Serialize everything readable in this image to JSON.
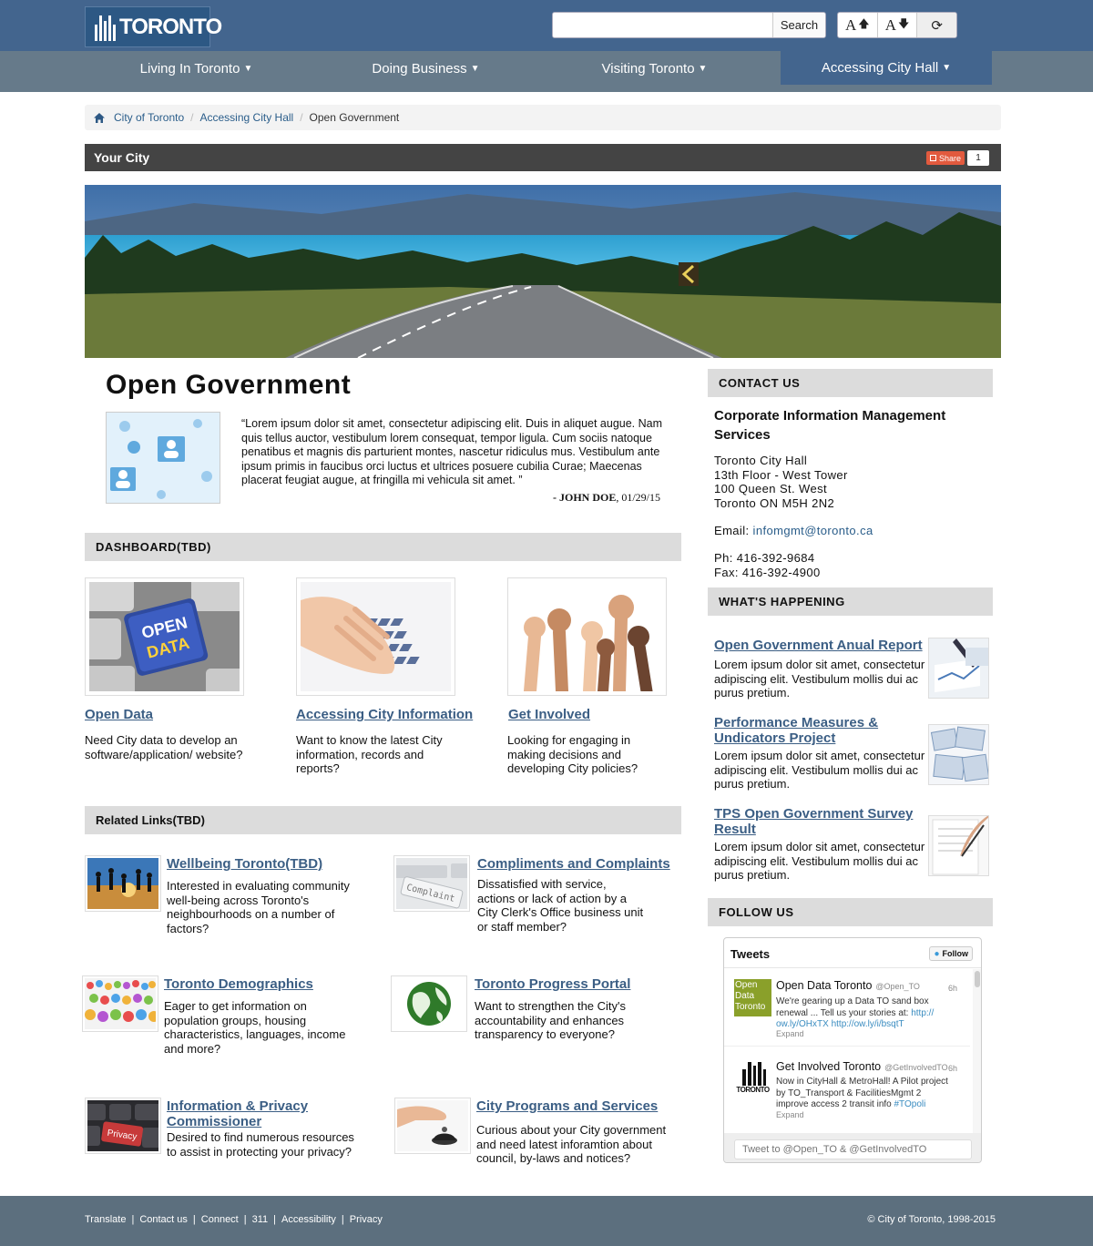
{
  "header": {
    "logo_text": "TORONTO",
    "search_placeholder": "",
    "search_button": "Search",
    "text_increase": "A",
    "text_decrease": "A",
    "up_arrow": "🡅",
    "down_arrow": "🡇",
    "refresh_glyph": "⟳"
  },
  "nav": [
    {
      "label": "Living In Toronto"
    },
    {
      "label": "Doing Business"
    },
    {
      "label": "Visiting Toronto"
    },
    {
      "label": "Accessing City Hall"
    }
  ],
  "breadcrumb": [
    "City of Toronto",
    "Accessing City Hall",
    "Open Government"
  ],
  "section_title": "Your City",
  "share": {
    "label": "Share",
    "count": "1"
  },
  "page_title": "Open Government",
  "quote": {
    "text": "“Lorem ipsum dolor sit amet, consectetur adipiscing elit. Duis in aliquet augue. Nam quis tellus auctor, vestibulum lorem consequat, tempor ligula. Cum sociis natoque penatibus et magnis dis parturient montes, nascetur ridiculus mus. Vestibulum ante ipsum primis in faucibus orci luctus et ultrices posuere cubilia Curae; Maecenas placerat feugiat augue, at fringilla mi vehicula sit amet. ”",
    "author": "- JOHN DOE",
    "date": ", 01/29/15"
  },
  "dashboard": {
    "heading": "DASHBOARD(TBD)",
    "open_data_overlay": [
      "OPEN",
      "DATA"
    ],
    "cards": [
      {
        "title": "Open Data",
        "desc": "Need City data to develop an software/application/ website?"
      },
      {
        "title": "Accessing City Information",
        "desc": "Want to know the latest City information, records and reports?"
      },
      {
        "title": "Get Involved",
        "desc": "Looking for engaging in making decisions and developing City policies?"
      }
    ]
  },
  "related": {
    "heading": "Related Links(TBD)",
    "complaint_overlay": "Complaint",
    "privacy_overlay": "Privacy",
    "items": [
      {
        "title": "Wellbeing Toronto(TBD)",
        "desc": "Interested in evaluating community well-being across Toronto's neighbourhoods on a number of factors?"
      },
      {
        "title": "Compliments and Complaints",
        "desc": "Dissatisfied with service, actions or lack of action by a City Clerk's Office business unit or staff member?"
      },
      {
        "title": "Toronto Demographics",
        "desc": "Eager to get information on population groups, housing characteristics, languages, income and more?"
      },
      {
        "title": "Toronto Progress Portal",
        "desc": "Want to strengthen the City's accountability and enhances transparency to everyone?"
      },
      {
        "title": "Information & Privacy Commissioner",
        "desc": "Desired to find numerous resources to assist in protecting your privacy?"
      },
      {
        "title": "City Programs and Services",
        "desc": "Curious about your City government and need latest inforamtion about council, by-laws and notices?"
      }
    ]
  },
  "contact": {
    "heading": "CONTACT US",
    "name": "Corporate Information Management Services",
    "address": [
      "Toronto City Hall",
      "13th Floor - West Tower",
      "100 Queen St. West",
      "Toronto ON M5H 2N2"
    ],
    "email_label": "Email: ",
    "email": "infomgmt@toronto.ca",
    "phone": "Ph: 416-392-9684",
    "fax": "Fax: 416-392-4900"
  },
  "whats_happening": {
    "heading": "WHAT'S HAPPENING",
    "items": [
      {
        "title": "Open Government Anual Report",
        "desc": "Lorem ipsum dolor sit amet, consectetur adipiscing elit. Vestibulum mollis dui ac purus pretium."
      },
      {
        "title": "Performance Measures & Undicators Project",
        "desc": "Lorem ipsum dolor sit amet, consectetur adipiscing elit. Vestibulum mollis dui ac purus pretium."
      },
      {
        "title": "TPS Open Government Survey Result",
        "desc": "Lorem ipsum dolor sit amet, consectetur adipiscing elit. Vestibulum mollis dui ac purus pretium."
      }
    ]
  },
  "follow": {
    "heading": "FOLLOW US",
    "tweets_title": "Tweets",
    "follow_button": "Follow",
    "tweets": [
      {
        "name": "Open Data Toronto",
        "handle": "@Open_TO",
        "time": "6h",
        "avatar_text": [
          "Open",
          "Data",
          "Toronto"
        ],
        "text": "We're gearing up a Data TO sand box renewal ... Tell us your stories at: ",
        "link1": "http:// ow.ly/OHxTX",
        "link2": "http://ow.ly/i/bsqtT",
        "expand": "Expand"
      },
      {
        "name": "Get Involved Toronto",
        "handle": "@GetInvolvedTO",
        "time": "6h",
        "avatar_text": [
          "TORONTO"
        ],
        "text": "Now in CityHall & MetroHall! A Pilot project by TO_Transport & FacilitiesMgmt 2 improve access 2 transit info ",
        "link1": "#TOpoli",
        "link2": "",
        "expand": "Expand"
      }
    ],
    "compose_placeholder": "Tweet to @Open_TO & @GetInvolvedTO"
  },
  "footer": {
    "links": [
      "Translate",
      "Contact us",
      "Connect",
      "311",
      "Accessibility",
      "Privacy"
    ],
    "separator": "|",
    "copyright": "© City of Toronto, 1998-2015"
  },
  "colors": {
    "header_blue": "#43658e",
    "nav_gray": "#667a8a",
    "link_blue": "#3b5e84",
    "footer": "#5c6f7e"
  }
}
